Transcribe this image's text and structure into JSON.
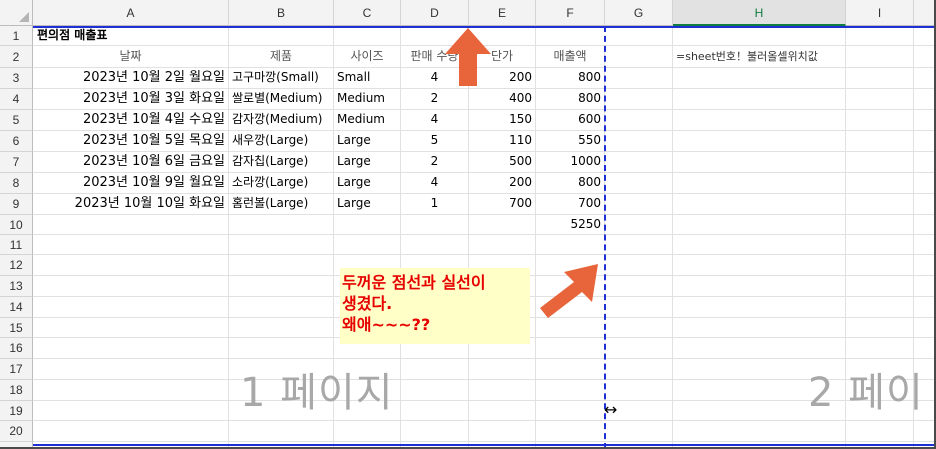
{
  "columns": [
    "A",
    "B",
    "C",
    "D",
    "E",
    "F",
    "G",
    "H",
    "I"
  ],
  "active_column": "H",
  "rows": [
    "1",
    "2",
    "3",
    "4",
    "5",
    "6",
    "7",
    "8",
    "9",
    "10",
    "11",
    "12",
    "13",
    "14",
    "15",
    "16",
    "17",
    "18",
    "19",
    "20"
  ],
  "sheet": {
    "title": "편의점 매출표",
    "headers": {
      "date": "날짜",
      "product": "제품",
      "size": "사이즈",
      "qty": "판매 수량",
      "price": "단가",
      "sales": "매출액"
    },
    "records": [
      {
        "date": "2023년 10월 2일 월요일",
        "product": "고구마깡(Small)",
        "size": "Small",
        "qty": "4",
        "price": "200",
        "sales": "800"
      },
      {
        "date": "2023년 10월 3일 화요일",
        "product": "쌀로별(Medium)",
        "size": "Medium",
        "qty": "2",
        "price": "400",
        "sales": "800"
      },
      {
        "date": "2023년 10월 4일 수요일",
        "product": "감자깡(Medium)",
        "size": "Medium",
        "qty": "4",
        "price": "150",
        "sales": "600"
      },
      {
        "date": "2023년 10월 5일 목요일",
        "product": "새우깡(Large)",
        "size": "Large",
        "qty": "5",
        "price": "110",
        "sales": "550"
      },
      {
        "date": "2023년 10월 6일 금요일",
        "product": "감자칩(Large)",
        "size": "Large",
        "qty": "2",
        "price": "500",
        "sales": "1000"
      },
      {
        "date": "2023년 10월 9일 월요일",
        "product": "소라깡(Large)",
        "size": "Large",
        "qty": "4",
        "price": "200",
        "sales": "800"
      },
      {
        "date": "2023년 10월 10일 화요일",
        "product": "홈런볼(Large)",
        "size": "Large",
        "qty": "1",
        "price": "700",
        "sales": "700"
      }
    ],
    "total": "5250",
    "formula_note": "=sheet번호！불러올셀위치값"
  },
  "watermarks": {
    "page1": "1 페이지",
    "page2": "2 페이"
  },
  "annotation": {
    "line1": "두꺼운 점선과 실선이",
    "line2": "생겼다.",
    "line3": "왜애~~~??"
  },
  "colors": {
    "arrow": "#e8643a",
    "note_text": "#e60000",
    "note_bg": "#ffffc7",
    "page_break": "#1f2fd6"
  },
  "icons": {
    "resize": "↔"
  }
}
